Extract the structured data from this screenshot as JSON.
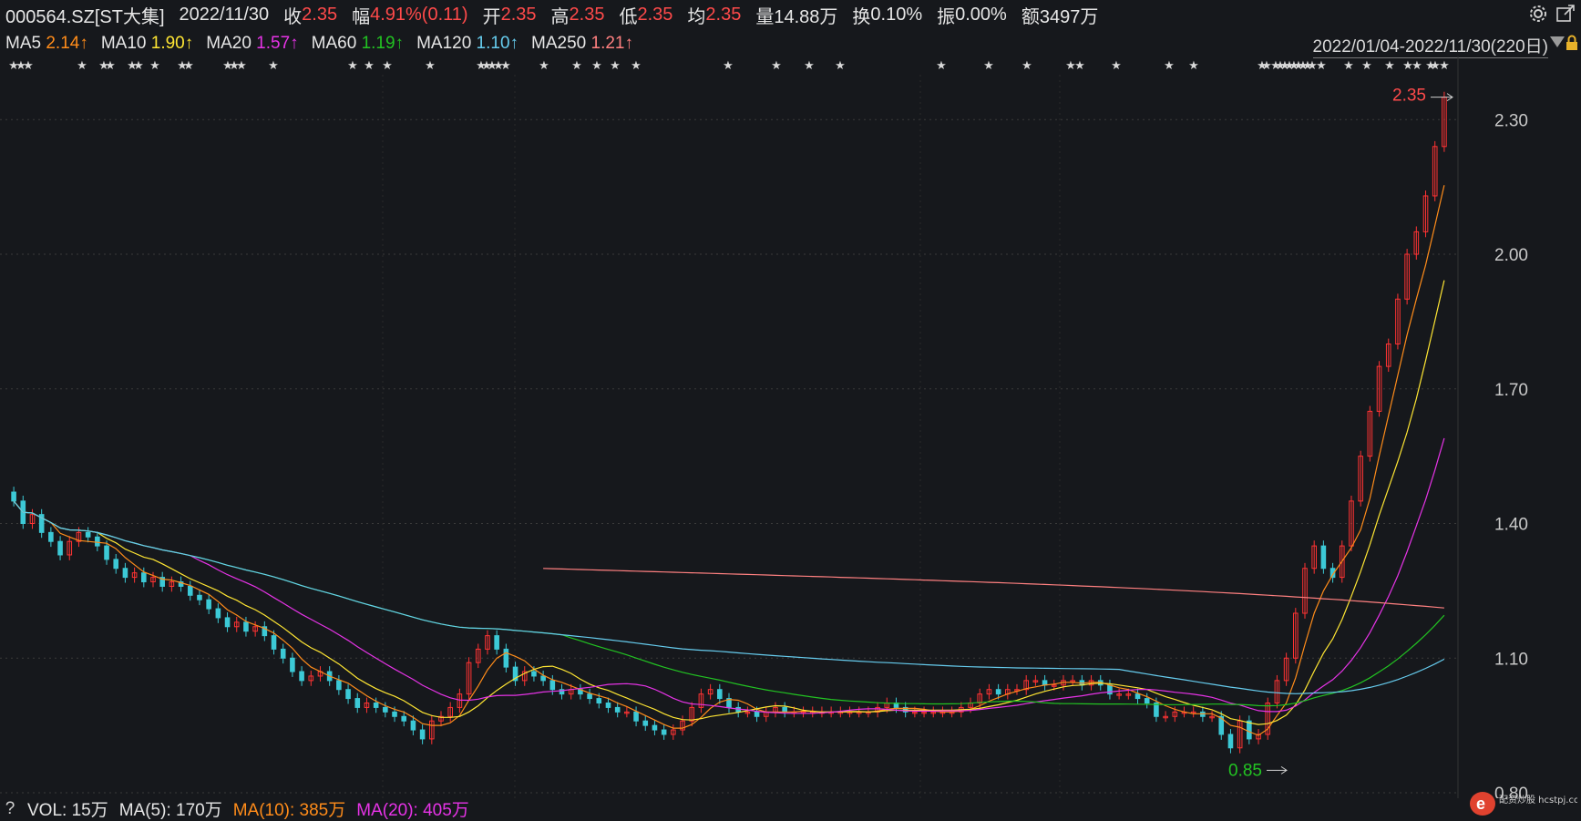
{
  "header": {
    "code": "000564.SZ[ST大集]",
    "date": "2022/11/30",
    "close_label": "收",
    "close_value": "2.35",
    "change_label": "幅",
    "change_value": "4.91%(0.11)",
    "open_label": "开",
    "open_value": "2.35",
    "high_label": "高",
    "high_value": "2.35",
    "low_label": "低",
    "low_value": "2.35",
    "avg_label": "均",
    "avg_value": "2.35",
    "volume_label": "量",
    "volume_value": "14.88万",
    "turnover_label": "换",
    "turnover_value": "0.10%",
    "amplitude_label": "振",
    "amplitude_value": "0.00%",
    "amount_label": "额",
    "amount_value": "3497万"
  },
  "ma_legend": [
    {
      "label": "MA5",
      "value": "2.14↑",
      "color": "#ff8c1a"
    },
    {
      "label": "MA10",
      "value": "1.90↑",
      "color": "#ffe633"
    },
    {
      "label": "MA20",
      "value": "1.57↑",
      "color": "#e633e6"
    },
    {
      "label": "MA60",
      "value": "1.19↑",
      "color": "#22c322"
    },
    {
      "label": "MA120",
      "value": "1.10↑",
      "color": "#66ccee"
    },
    {
      "label": "MA250",
      "value": "1.21↑",
      "color": "#ff8080"
    }
  ],
  "date_range": "2022/01/04-2022/11/30(220日)",
  "icons": [
    "settings-icon",
    "exit-fullscreen-icon",
    "dropdown-arrow-icon",
    "lock-icon"
  ],
  "annotations": {
    "max_label": "2.35",
    "min_label": "0.85",
    "star_symbol": "★"
  },
  "volume_legend": {
    "help": "?",
    "vol": "VOL: 15万",
    "ma5": "MA(5): 170万",
    "ma10": "MA(10): 385万",
    "ma20": "MA(20): 405万",
    "colors": {
      "vol": "#e6e6e6",
      "ma5": "#e6e6e6",
      "ma10": "#ff8c1a",
      "ma20": "#e633e6"
    }
  },
  "watermark": "配资炒股 hcstpj.com",
  "chart_data": {
    "type": "candlestick",
    "x_range": [
      "2022/01/04",
      "2022/11/30"
    ],
    "trading_days": 220,
    "ylim": [
      0.8,
      2.4
    ],
    "yticks": [
      "2.30",
      "2.00",
      "1.70",
      "1.40",
      "1.10",
      "0.80"
    ],
    "up_color": "#ff3333",
    "down_color": "#3cc9d6",
    "close": [
      1.45,
      1.4,
      1.42,
      1.38,
      1.36,
      1.33,
      1.36,
      1.38,
      1.37,
      1.35,
      1.32,
      1.3,
      1.28,
      1.29,
      1.27,
      1.28,
      1.26,
      1.27,
      1.26,
      1.24,
      1.23,
      1.21,
      1.19,
      1.17,
      1.18,
      1.16,
      1.17,
      1.15,
      1.12,
      1.1,
      1.07,
      1.05,
      1.06,
      1.07,
      1.05,
      1.03,
      1.01,
      0.99,
      1.0,
      0.99,
      0.98,
      0.97,
      0.96,
      0.94,
      0.92,
      0.96,
      0.97,
      0.99,
      1.02,
      1.09,
      1.12,
      1.15,
      1.12,
      1.08,
      1.05,
      1.07,
      1.06,
      1.05,
      1.03,
      1.02,
      1.03,
      1.02,
      1.01,
      1.0,
      0.99,
      0.98,
      0.98,
      0.96,
      0.95,
      0.94,
      0.93,
      0.94,
      0.96,
      0.99,
      1.02,
      1.03,
      1.01,
      0.99,
      0.98,
      0.98,
      0.97,
      0.98,
      0.99,
      0.98,
      0.98,
      0.98,
      0.98,
      0.98,
      0.98,
      0.98,
      0.98,
      0.98,
      0.98,
      0.99,
      1.0,
      0.99,
      0.98,
      0.98,
      0.98,
      0.98,
      0.98,
      0.98,
      0.99,
      1.0,
      1.02,
      1.03,
      1.02,
      1.03,
      1.03,
      1.05,
      1.05,
      1.04,
      1.04,
      1.05,
      1.05,
      1.04,
      1.05,
      1.04,
      1.02,
      1.02,
      1.02,
      1.01,
      1.0,
      0.97,
      0.97,
      0.98,
      0.98,
      0.98,
      0.97,
      0.97,
      0.93,
      0.9,
      0.96,
      0.92,
      0.93,
      1.0,
      1.05,
      1.1,
      1.2,
      1.3,
      1.35,
      1.3,
      1.28,
      1.35,
      1.45,
      1.55,
      1.65,
      1.75,
      1.8,
      1.9,
      2.0,
      2.05,
      2.13,
      2.24,
      2.35
    ],
    "ma5_last": 2.14,
    "ma10_last": 1.9,
    "ma20_last": 1.57,
    "ma60_last": 1.19,
    "ma120_last": 1.1,
    "ma250_last": 1.21,
    "max_price": 2.35,
    "min_price": 0.85
  }
}
